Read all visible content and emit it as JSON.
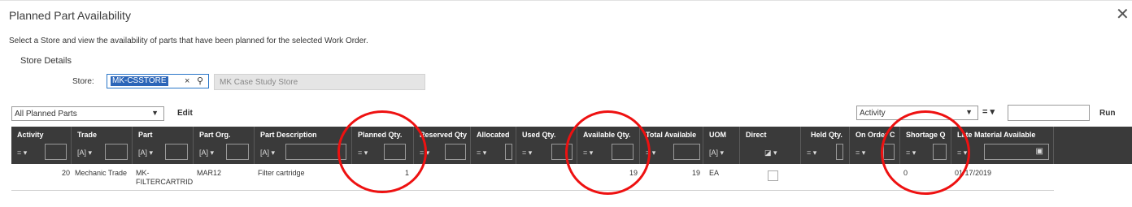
{
  "dialog": {
    "title": "Planned Part Availability",
    "close_label": "✕",
    "description": "Select a Store and view the availability of parts that have been planned for the selected Work Order.",
    "section_title": "Store Details"
  },
  "store": {
    "label": "Store:",
    "value": "MK-CSSTORE",
    "clear_label": "×",
    "search_label": "⚲",
    "description": "MK Case Study Store"
  },
  "toolbar": {
    "filter_value": "All Planned Parts",
    "edit_label": "Edit",
    "column_filter_value": "Activity",
    "operator_label": "= ▾",
    "run_label": "Run"
  },
  "columns": [
    {
      "label": "Activity",
      "filter": "= ▾"
    },
    {
      "label": "Trade",
      "filter": "[A] ▾"
    },
    {
      "label": "Part",
      "filter": "[A] ▾"
    },
    {
      "label": "Part Org.",
      "filter": "[A] ▾"
    },
    {
      "label": "Part Description",
      "filter": "[A] ▾"
    },
    {
      "label": "Planned Qty.",
      "filter": "= ▾"
    },
    {
      "label": "Reserved Qty",
      "filter": "= ▾"
    },
    {
      "label": "Allocated",
      "filter": "= ▾"
    },
    {
      "label": "Used Qty.",
      "filter": "= ▾"
    },
    {
      "label": "Available Qty.",
      "filter": "= ▾"
    },
    {
      "label": "Total Available",
      "filter": "= ▾"
    },
    {
      "label": "UOM",
      "filter": "[A] ▾"
    },
    {
      "label": "Direct",
      "filter": "◪ ▾"
    },
    {
      "label": "Held Qty.",
      "filter": "= ▾"
    },
    {
      "label": "On Order C",
      "filter": "= ▾"
    },
    {
      "label": "Shortage Q",
      "filter": "= ▾"
    },
    {
      "label": "Late Material Available",
      "filter": "= ▾"
    }
  ],
  "row": {
    "activity": "20",
    "trade": "Mechanic Trade",
    "part_line1": "MK-",
    "part_line2": "FILTERCARTRID",
    "part_org": "MAR12",
    "part_description": "Filter cartridge",
    "planned_qty": "1",
    "available_qty": "19",
    "total_available": "19",
    "uom": "EA",
    "shortage_qty": "0",
    "late_material_available": "01/17/2019"
  },
  "colors": {
    "header_bg": "#3a3a3a",
    "annotation_circle": "#e11111",
    "selection": "#2b65b8"
  }
}
